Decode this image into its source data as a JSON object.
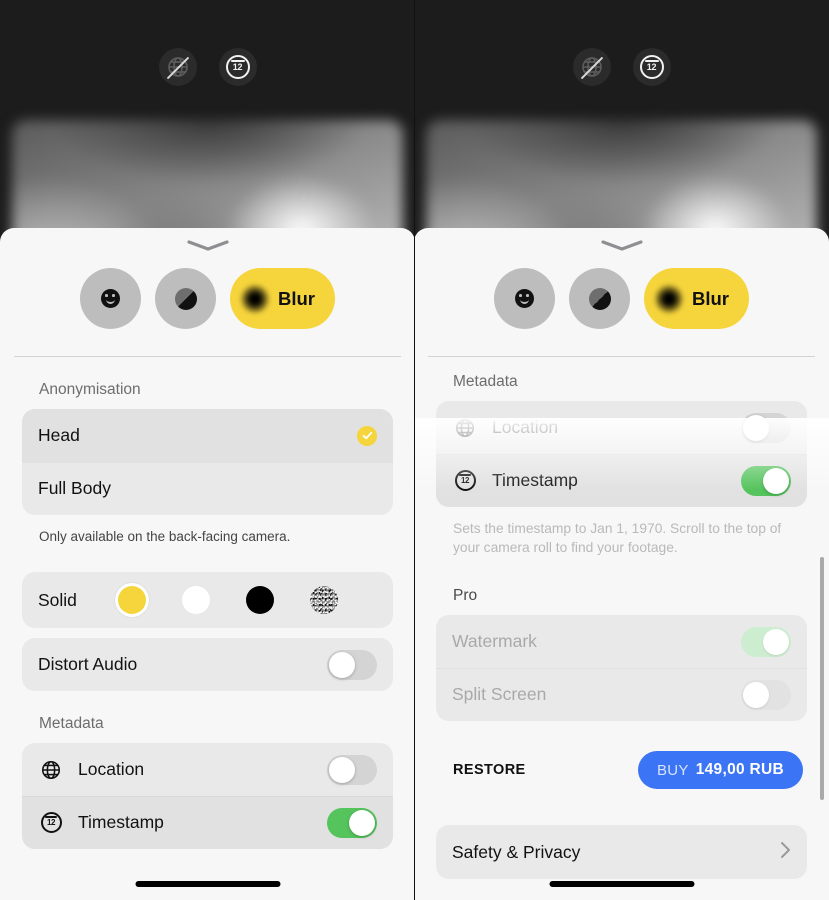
{
  "app": {
    "topbar": {
      "icons": [
        {
          "name": "location-off-icon",
          "label": "Location off"
        },
        {
          "name": "timestamp-icon",
          "label": "12"
        }
      ]
    },
    "mode_selector": {
      "options": [
        {
          "name": "face-mode",
          "label": ""
        },
        {
          "name": "solid-mode",
          "label": ""
        },
        {
          "name": "blur-mode",
          "label": "Blur",
          "selected": true
        }
      ]
    },
    "colors": {
      "accent_yellow": "#F5D43C",
      "toggle_green": "#55C45D",
      "buy_blue": "#3B74F5",
      "sheet_bg": "#F7F7F7",
      "card_bg": "#E9E9E9"
    }
  },
  "left_panel": {
    "anonymisation": {
      "section_label": "Anonymisation",
      "items": [
        {
          "label": "Head",
          "selected": true
        },
        {
          "label": "Full Body",
          "selected": false
        }
      ],
      "footnote": "Only available on the back-facing camera."
    },
    "solid": {
      "label": "Solid",
      "swatches": [
        {
          "name": "yellow",
          "color": "#F5D43C",
          "selected": true
        },
        {
          "name": "white",
          "color": "#FFFFFF",
          "selected": false
        },
        {
          "name": "black",
          "color": "#000000",
          "selected": false
        },
        {
          "name": "noise",
          "color": "#8A8A8A",
          "selected": false
        }
      ]
    },
    "distort_audio": {
      "label": "Distort Audio",
      "enabled": false
    },
    "metadata": {
      "section_label": "Metadata",
      "items": [
        {
          "label": "Location",
          "icon": "globe-icon",
          "enabled": false
        },
        {
          "label": "Timestamp",
          "icon": "clock-12-icon",
          "enabled": true
        }
      ]
    }
  },
  "right_panel": {
    "metadata": {
      "section_label": "Metadata",
      "items": [
        {
          "label": "Location",
          "icon": "globe-icon",
          "enabled": false
        },
        {
          "label": "Timestamp",
          "icon": "clock-12-icon",
          "enabled": true
        }
      ],
      "footnote": "Sets the timestamp to Jan 1, 1970. Scroll to the top of your camera roll to find your footage."
    },
    "pro": {
      "section_label": "Pro",
      "items": [
        {
          "label": "Watermark",
          "enabled": true,
          "disabled": true
        },
        {
          "label": "Split Screen",
          "enabled": false,
          "disabled": true
        }
      ],
      "restore_label": "RESTORE",
      "buy_word": "BUY",
      "buy_price": "149,00 RUB"
    },
    "safety": {
      "label": "Safety & Privacy"
    }
  }
}
